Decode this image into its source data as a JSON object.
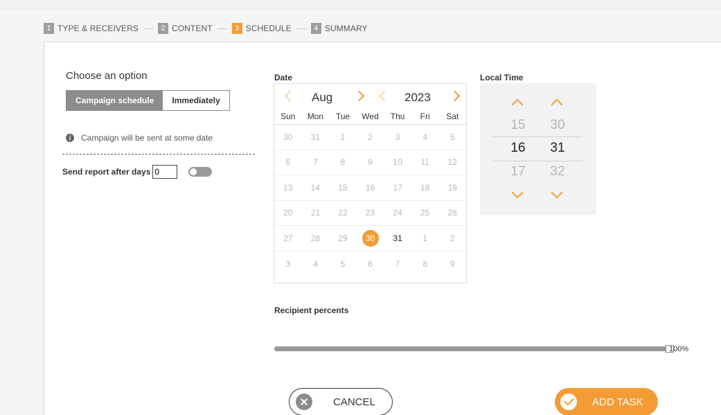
{
  "stepper": {
    "steps": [
      {
        "num": "1",
        "label": "TYPE & RECEIVERS"
      },
      {
        "num": "2",
        "label": "CONTENT"
      },
      {
        "num": "3",
        "label": "SCHEDULE"
      },
      {
        "num": "4",
        "label": "SUMMARY"
      }
    ],
    "separator": "·······",
    "active_step": 3
  },
  "options": {
    "title": "Choose an option",
    "campaign_schedule": "Campaign schedule",
    "immediately": "Immediately",
    "selected": "Campaign schedule",
    "info_text": "Campaign will be sent at some date",
    "report_label": "Send report after days",
    "report_value": "0",
    "report_toggle": false
  },
  "calendar": {
    "label": "Date",
    "month": "Aug",
    "year": "2023",
    "weekdays": [
      "Sun",
      "Mon",
      "Tue",
      "Wed",
      "Thu",
      "Fri",
      "Sat"
    ],
    "weeks": [
      [
        "30",
        "31",
        "1",
        "2",
        "3",
        "4",
        "5"
      ],
      [
        "6",
        "7",
        "8",
        "9",
        "10",
        "11",
        "12"
      ],
      [
        "13",
        "14",
        "15",
        "16",
        "17",
        "18",
        "19"
      ],
      [
        "20",
        "21",
        "22",
        "23",
        "24",
        "25",
        "26"
      ],
      [
        "27",
        "28",
        "29",
        "30",
        "31",
        "1",
        "2"
      ],
      [
        "3",
        "4",
        "5",
        "6",
        "7",
        "8",
        "9"
      ]
    ],
    "selected_day": "30",
    "enabled_days": [
      "31"
    ]
  },
  "time": {
    "label": "Local Time",
    "hours": {
      "prev": "15",
      "current": "16",
      "next": "17"
    },
    "minutes": {
      "prev": "30",
      "current": "31",
      "next": "32"
    }
  },
  "recipients": {
    "label": "Recipient percents",
    "value": 100,
    "value_text": "100",
    "suffix": "%"
  },
  "actions": {
    "cancel": "CANCEL",
    "add": "ADD TASK"
  },
  "colors": {
    "accent": "#f39c36",
    "muted": "#8c8c8c"
  }
}
